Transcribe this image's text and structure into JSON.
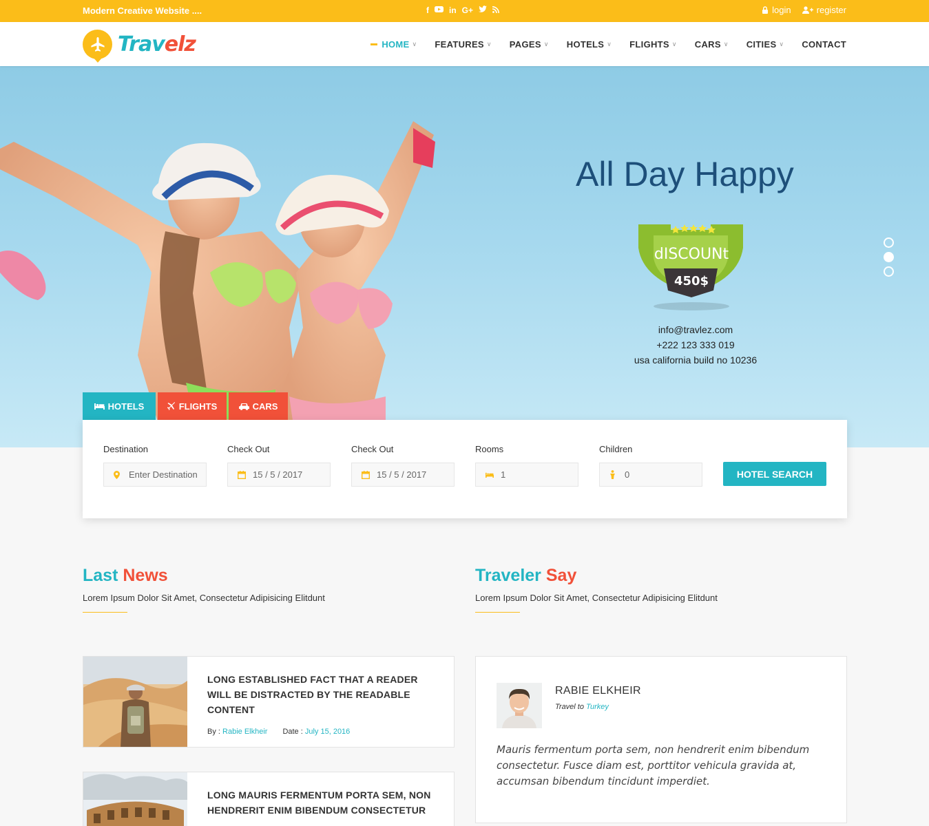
{
  "topbar": {
    "tagline": "Modern Creative Website ....",
    "socials": [
      "f",
      "yt",
      "in",
      "G+",
      "tw",
      "rss"
    ],
    "login": "login",
    "register": "register"
  },
  "header": {
    "logo_part1": "Trav",
    "logo_part2": "elz",
    "nav": [
      "HOME",
      "FEATURES",
      "PAGES",
      "HOTELS",
      "FLIGHTS",
      "CARS",
      "CITIES",
      "CONTACT"
    ]
  },
  "hero": {
    "title": "All Day Happy",
    "badge_label": "dISCOUNt",
    "badge_price": "450$",
    "email": "info@travlez.com",
    "phone": "+222 123 333 019",
    "address": "usa california build no 10236",
    "slides": 3,
    "active_slide": 2
  },
  "tabs": {
    "hotels": "HOTELS",
    "flights": "FLIGHTS",
    "cars": "CARS"
  },
  "search": {
    "destination_label": "Destination",
    "destination_placeholder": "Enter Destination",
    "checkin_label": "Check Out",
    "checkin_value": "15 / 5 / 2017",
    "checkout_label": "Check Out",
    "checkout_value": "15 / 5 / 2017",
    "rooms_label": "Rooms",
    "rooms_value": "1",
    "children_label": "Children",
    "children_value": "0",
    "button": "HOTEL SEARCH"
  },
  "news_section": {
    "title_a": "Last",
    "title_b": "News",
    "subtitle": "Lorem Ipsum Dolor Sit Amet, Consectetur Adipisicing Elitdunt",
    "items": [
      {
        "title": "LONG ESTABLISHED FACT THAT A READER WILL BE DISTRACTED BY THE READABLE CONTENT",
        "by_label": "By :",
        "author": "Rabie Elkheir",
        "date_label": "Date :",
        "date": "July 15, 2016"
      },
      {
        "title": "LONG MAURIS FERMENTUM PORTA SEM, NON HENDRERIT ENIM BIBENDUM CONSECTETUR"
      }
    ]
  },
  "testimonials": {
    "title_a": "Traveler",
    "title_b": "Say",
    "subtitle": "Lorem Ipsum Dolor Sit Amet, Consectetur Adipisicing Elitdunt",
    "name": "RABIE ELKHEIR",
    "travel_label": "Travel to",
    "travel_dest": "Turkey",
    "quote": "Mauris fermentum porta sem, non hendrerit enim bibendum consectetur. Fusce diam est, porttitor vehicula gravida at, accumsan bibendum tincidunt imperdiet."
  },
  "colors": {
    "yellow": "#fbbd19",
    "teal": "#23b5c3",
    "red": "#f15139"
  }
}
